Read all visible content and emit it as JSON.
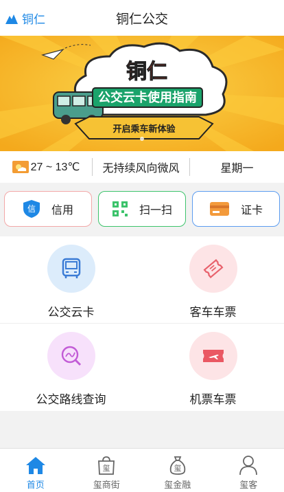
{
  "header": {
    "city": "铜仁",
    "title": "铜仁公交"
  },
  "banner": {
    "headline": "铜仁",
    "subtitle": "公交云卡使用指南",
    "ribbon": "开启乘车新体验"
  },
  "weather": {
    "temperature": "27 ~ 13℃",
    "wind": "无持续风向微风",
    "weekday": "星期一"
  },
  "actions": [
    {
      "label": "信用",
      "icon_text": "信",
      "icon": "shield-icon",
      "color": "#f2a7a7"
    },
    {
      "label": "扫一扫",
      "icon": "qr-scan-icon",
      "color": "#3cc36b"
    },
    {
      "label": "证卡",
      "icon": "card-icon",
      "color": "#5b9cf0"
    }
  ],
  "services": [
    {
      "label": "公交云卡",
      "icon": "bus-icon"
    },
    {
      "label": "客车车票",
      "icon": "ticket-icon"
    },
    {
      "label": "公交路线查询",
      "icon": "route-search-icon"
    },
    {
      "label": "机票车票",
      "icon": "flight-ticket-icon"
    }
  ],
  "tabs": [
    {
      "label": "首页",
      "icon": "home-icon",
      "active": true
    },
    {
      "label": "玺商街",
      "icon": "shopping-bag-icon",
      "badge": "玺",
      "active": false
    },
    {
      "label": "玺金融",
      "icon": "money-bag-icon",
      "badge": "玺",
      "active": false
    },
    {
      "label": "玺客",
      "icon": "user-icon",
      "active": false
    }
  ],
  "colors": {
    "accent": "#1e88e5",
    "banner_bg": "#f7b72b"
  }
}
